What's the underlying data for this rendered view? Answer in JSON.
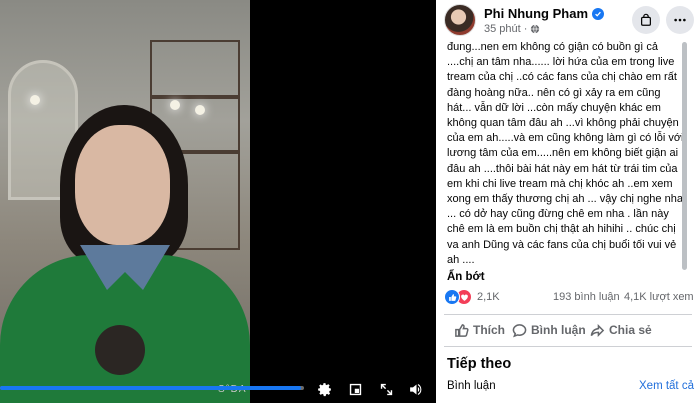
{
  "video": {
    "watermark": "S°DA",
    "progress": 0.99
  },
  "post": {
    "author": "Phi Nhung Pham",
    "timestamp": "35 phút",
    "caption": "đung...nen em không có giận có buồn gì cả ....chị an tâm nha...... lời hứa của em trong live tream của chị ..có các fans của chị chào em rất đàng hoàng nữa.. nên có gì xảy ra em cũng hát... vẫn dữ lời ...còn mấy chuyện khác em không quan tâm đâu ah ...vì không phải chuyện của em ah.....và em cũng không làm gì có lỗi với lương tâm của em.....nên em không biết giận ai đâu ah ....thôi bài hát này em hát từ trái tim của em khi chi live tream mà chị khóc ah ..em xem\nxong em thấy thương chị ah ... vậy chị nghe nha ... có dở hay cũng đừng chê em nha . lần này chê em là em buồn chị thật ah hihihi .. chúc chị va anh Dũng và các fans của chị buổi tối vui vẻ ah ....",
    "see_less": "Ẩn bớt"
  },
  "stats": {
    "reactions": "2,1K",
    "comments": "193 bình luận",
    "views": "4,1K lượt xem"
  },
  "actions": {
    "like": "Thích",
    "comment": "Bình luận",
    "share": "Chia sẻ"
  },
  "next": {
    "title": "Tiếp theo",
    "comments_label": "Bình luận",
    "see_all": "Xem tất cả"
  },
  "colors": {
    "accent": "#1877f2",
    "love": "#f33e58",
    "link": "#216fdb"
  },
  "icons": [
    "settings-icon",
    "pip-icon",
    "fullscreen-icon",
    "volume-icon",
    "verified-icon",
    "globe-icon",
    "bag-icon",
    "more-icon",
    "like-icon",
    "love-icon",
    "comment-icon",
    "share-icon"
  ]
}
